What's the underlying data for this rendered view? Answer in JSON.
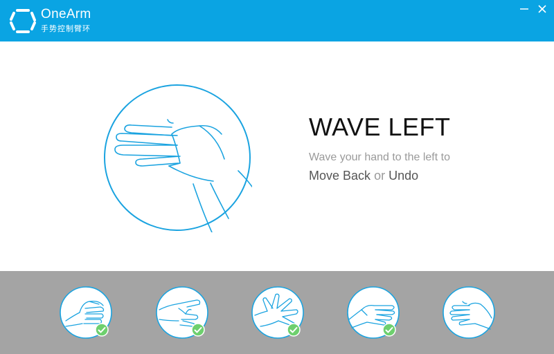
{
  "app": {
    "name": "OneArm",
    "subtitle": "手势控制臂环"
  },
  "window_controls": {
    "minimize": "minimize-icon",
    "close": "close-icon"
  },
  "gesture": {
    "title": "WAVE LEFT",
    "description": "Wave your hand to the left to",
    "action_primary": "Move Back",
    "action_connector": "or",
    "action_secondary": "Undo"
  },
  "thumbnails": [
    {
      "icon": "fist-hand-icon",
      "completed": true
    },
    {
      "icon": "pinch-hand-icon",
      "completed": true
    },
    {
      "icon": "spread-fingers-hand-icon",
      "completed": true
    },
    {
      "icon": "wave-right-hand-icon",
      "completed": true
    },
    {
      "icon": "wave-left-hand-icon",
      "completed": false
    }
  ],
  "colors": {
    "accent": "#0aa4e3",
    "check": "#6ed06e",
    "footer": "#a4a4a4"
  }
}
